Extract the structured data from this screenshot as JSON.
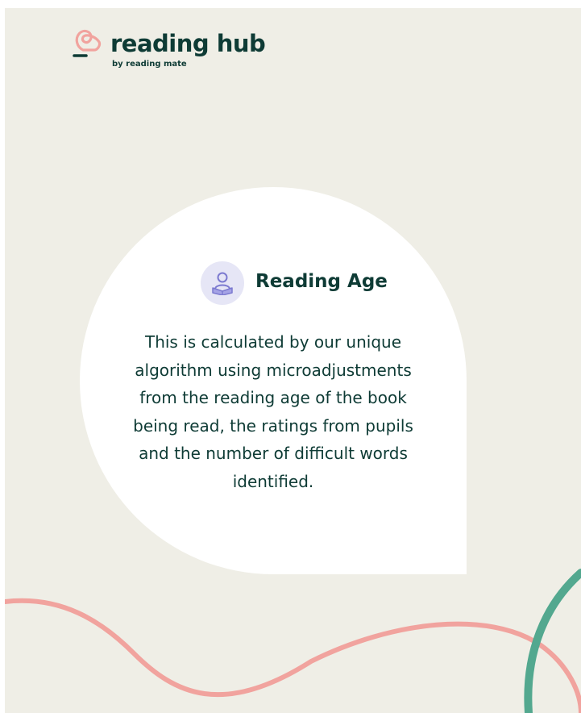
{
  "brand": {
    "title": "reading hub",
    "subtitle": "by reading mate"
  },
  "card": {
    "icon": "reader-icon",
    "title": "Reading Age",
    "description": "This is calculated by our unique algorithm using microadjustments from the reading age of the book being read, the ratings from pupils and the number of difficult words identified."
  },
  "colors": {
    "background": "#efeee6",
    "text": "#0e3b35",
    "accent_pink": "#f1a39e",
    "accent_green": "#53a88f",
    "icon_bg": "#e6e6f6",
    "icon_fg": "#7c7ad0"
  }
}
